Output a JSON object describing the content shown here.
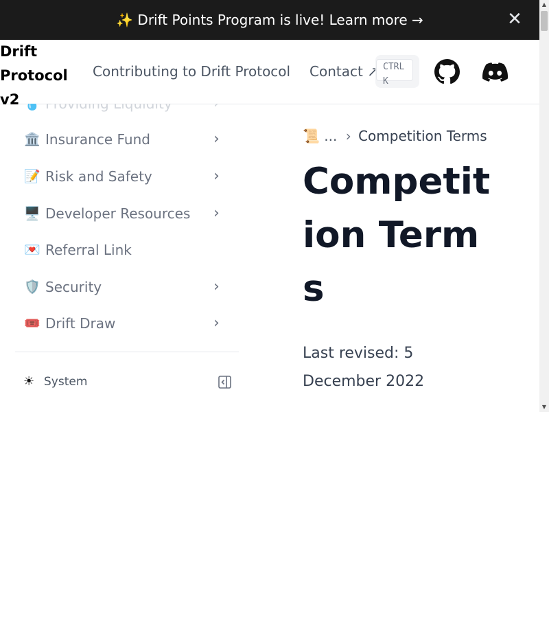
{
  "banner": {
    "text": "✨ Drift Points Program is live! Learn more →",
    "close_icon": "close-icon",
    "close_glyph": "✕"
  },
  "navbar": {
    "logo": "Drift Protocol v2",
    "links": [
      {
        "label": "Contributing to Drift Protocol"
      },
      {
        "label": "Contact ↗"
      }
    ],
    "search_shortcut": "CTRL K",
    "github_icon": "github-icon",
    "discord_icon": "discord-icon"
  },
  "sidebar": {
    "items": [
      {
        "emoji": "💧",
        "label": "Providing Liquidity",
        "chevron": "›",
        "faded": true
      },
      {
        "emoji": "🏛️",
        "label": "Insurance Fund",
        "chevron": "›"
      },
      {
        "emoji": "📝",
        "label": "Risk and Safety",
        "chevron": "›"
      },
      {
        "emoji": "🖥️",
        "label": "Developer Resources",
        "chevron": "›"
      },
      {
        "emoji": "💌",
        "label": "Referral Link",
        "chevron": ""
      },
      {
        "emoji": "🛡️",
        "label": "Security",
        "chevron": "›"
      },
      {
        "emoji": "🎟️",
        "label": "Drift Draw",
        "chevron": "›"
      }
    ],
    "theme": {
      "icon": "sun-icon",
      "glyph": "☀",
      "label": "System"
    },
    "collapse_icon": "sidebar-collapse-icon"
  },
  "main": {
    "breadcrumb": {
      "emoji": "📜",
      "ellipsis": "...",
      "separator": "›",
      "current": "Competition Terms"
    },
    "title": "Competition Terms",
    "last_revised": "Last revised: 5 December 2022"
  },
  "scrollbar": {
    "up": "▲",
    "down": "▼"
  }
}
